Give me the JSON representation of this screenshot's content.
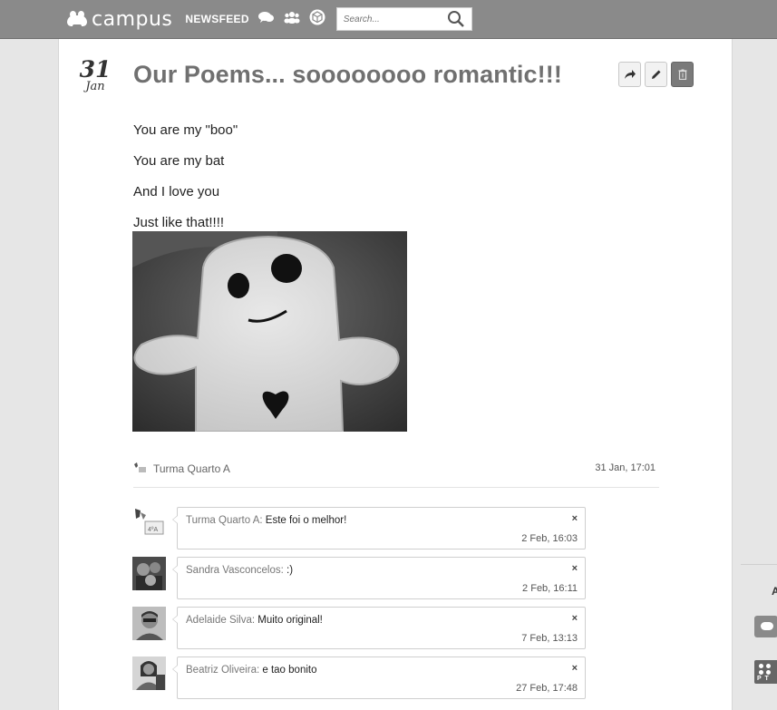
{
  "header": {
    "logo_text": "campus",
    "nav_newsfeed": "NEWSFEED",
    "search_placeholder": "Search..."
  },
  "post": {
    "date_day": "31",
    "date_month": "Jan",
    "title": "Our Poems... soooooooo romantic!!!",
    "lines": [
      "You are my \"boo\"",
      "You are my bat",
      "And I love you",
      "Just like that!!!!"
    ],
    "author": "Turma Quarto A",
    "timestamp": "31 Jan, 17:01"
  },
  "comments": [
    {
      "author": "Turma Quarto A:",
      "text": "Este foi o melhor!",
      "time": "2 Feb, 16:03",
      "close": "×"
    },
    {
      "author": "Sandra Vasconcelos:",
      "text": ":)",
      "time": "2 Feb, 16:11",
      "close": "×"
    },
    {
      "author": "Adelaide Silva:",
      "text": "Muito original!",
      "time": "7 Feb, 13:13",
      "close": "×"
    },
    {
      "author": "Beatriz Oliveira:",
      "text": "e tao bonito",
      "time": "27 Feb, 17:48",
      "close": "×"
    }
  ],
  "sidebar": {
    "letter": "A",
    "logo_letters": "P T"
  },
  "icons": {
    "share": "share-icon",
    "edit": "pencil-icon",
    "delete": "trash-icon",
    "chat": "chat-icon",
    "groups": "group-icon",
    "cube": "cube-icon",
    "search": "search-icon"
  }
}
